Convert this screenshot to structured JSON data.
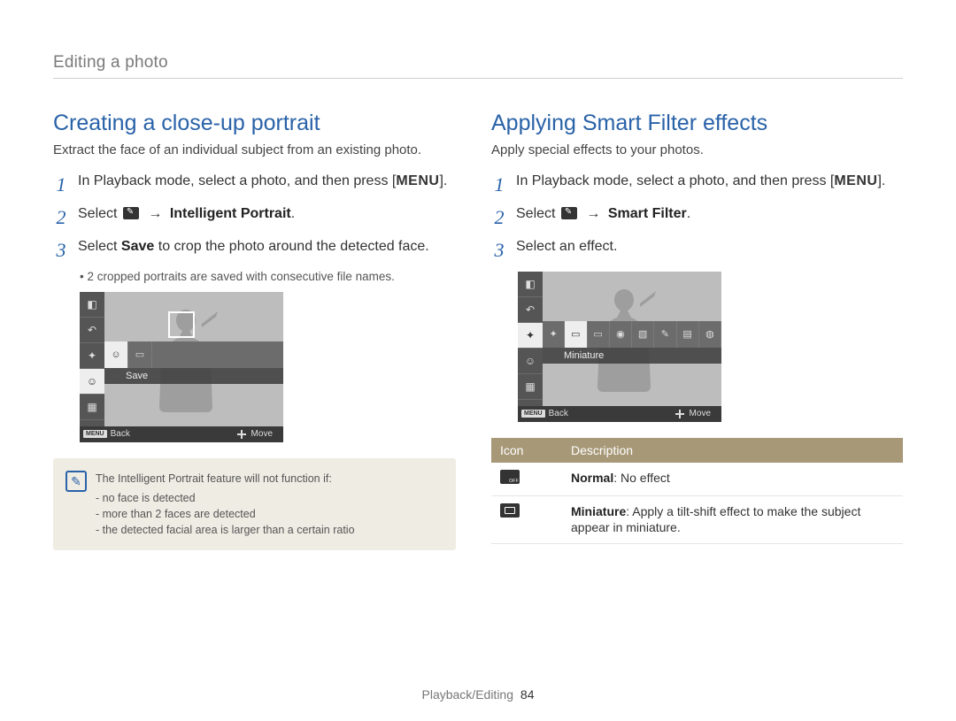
{
  "breadcrumb": "Editing a photo",
  "left": {
    "title": "Creating a close-up portrait",
    "intro": "Extract the face of an individual subject from an existing photo.",
    "step1a": "In Playback mode, select a photo, and then press [",
    "step1_menu": "MENU",
    "step1b": "].",
    "step2a": "Select ",
    "step2_arrow": " → ",
    "step2_target": "Intelligent Portrait",
    "step2b": ".",
    "step3a": "Select ",
    "step3_bold": "Save",
    "step3b": " to crop the photo around the detected face.",
    "step3_sub": "2 cropped portraits are saved with consecutive file names.",
    "lcd_label": "Save",
    "lcd_back": "Back",
    "lcd_move": "Move",
    "lcd_menu_btn": "MENU",
    "note_lead": "The Intelligent Portrait feature will not function if:",
    "note_items": [
      "no face is detected",
      "more than 2 faces are detected",
      "the detected facial area is larger than a certain ratio"
    ]
  },
  "right": {
    "title": "Applying Smart Filter effects",
    "intro": "Apply special effects to your photos.",
    "step1a": "In Playback mode, select a photo, and then press [",
    "step1_menu": "MENU",
    "step1b": "].",
    "step2a": "Select ",
    "step2_arrow": " → ",
    "step2_target": "Smart Filter",
    "step2b": ".",
    "step3": "Select an effect.",
    "lcd_label": "Miniature",
    "lcd_back": "Back",
    "lcd_move": "Move",
    "lcd_menu_btn": "MENU",
    "table": {
      "h_icon": "Icon",
      "h_desc": "Description",
      "r1_name": "Normal",
      "r1_desc": ": No effect",
      "r2_name": "Miniature",
      "r2_desc": ": Apply a tilt-shift effect to make the subject appear in miniature."
    }
  },
  "footer_section": "Playback/Editing",
  "footer_page": "84",
  "nums": {
    "one": "1",
    "two": "2",
    "three": "3"
  }
}
